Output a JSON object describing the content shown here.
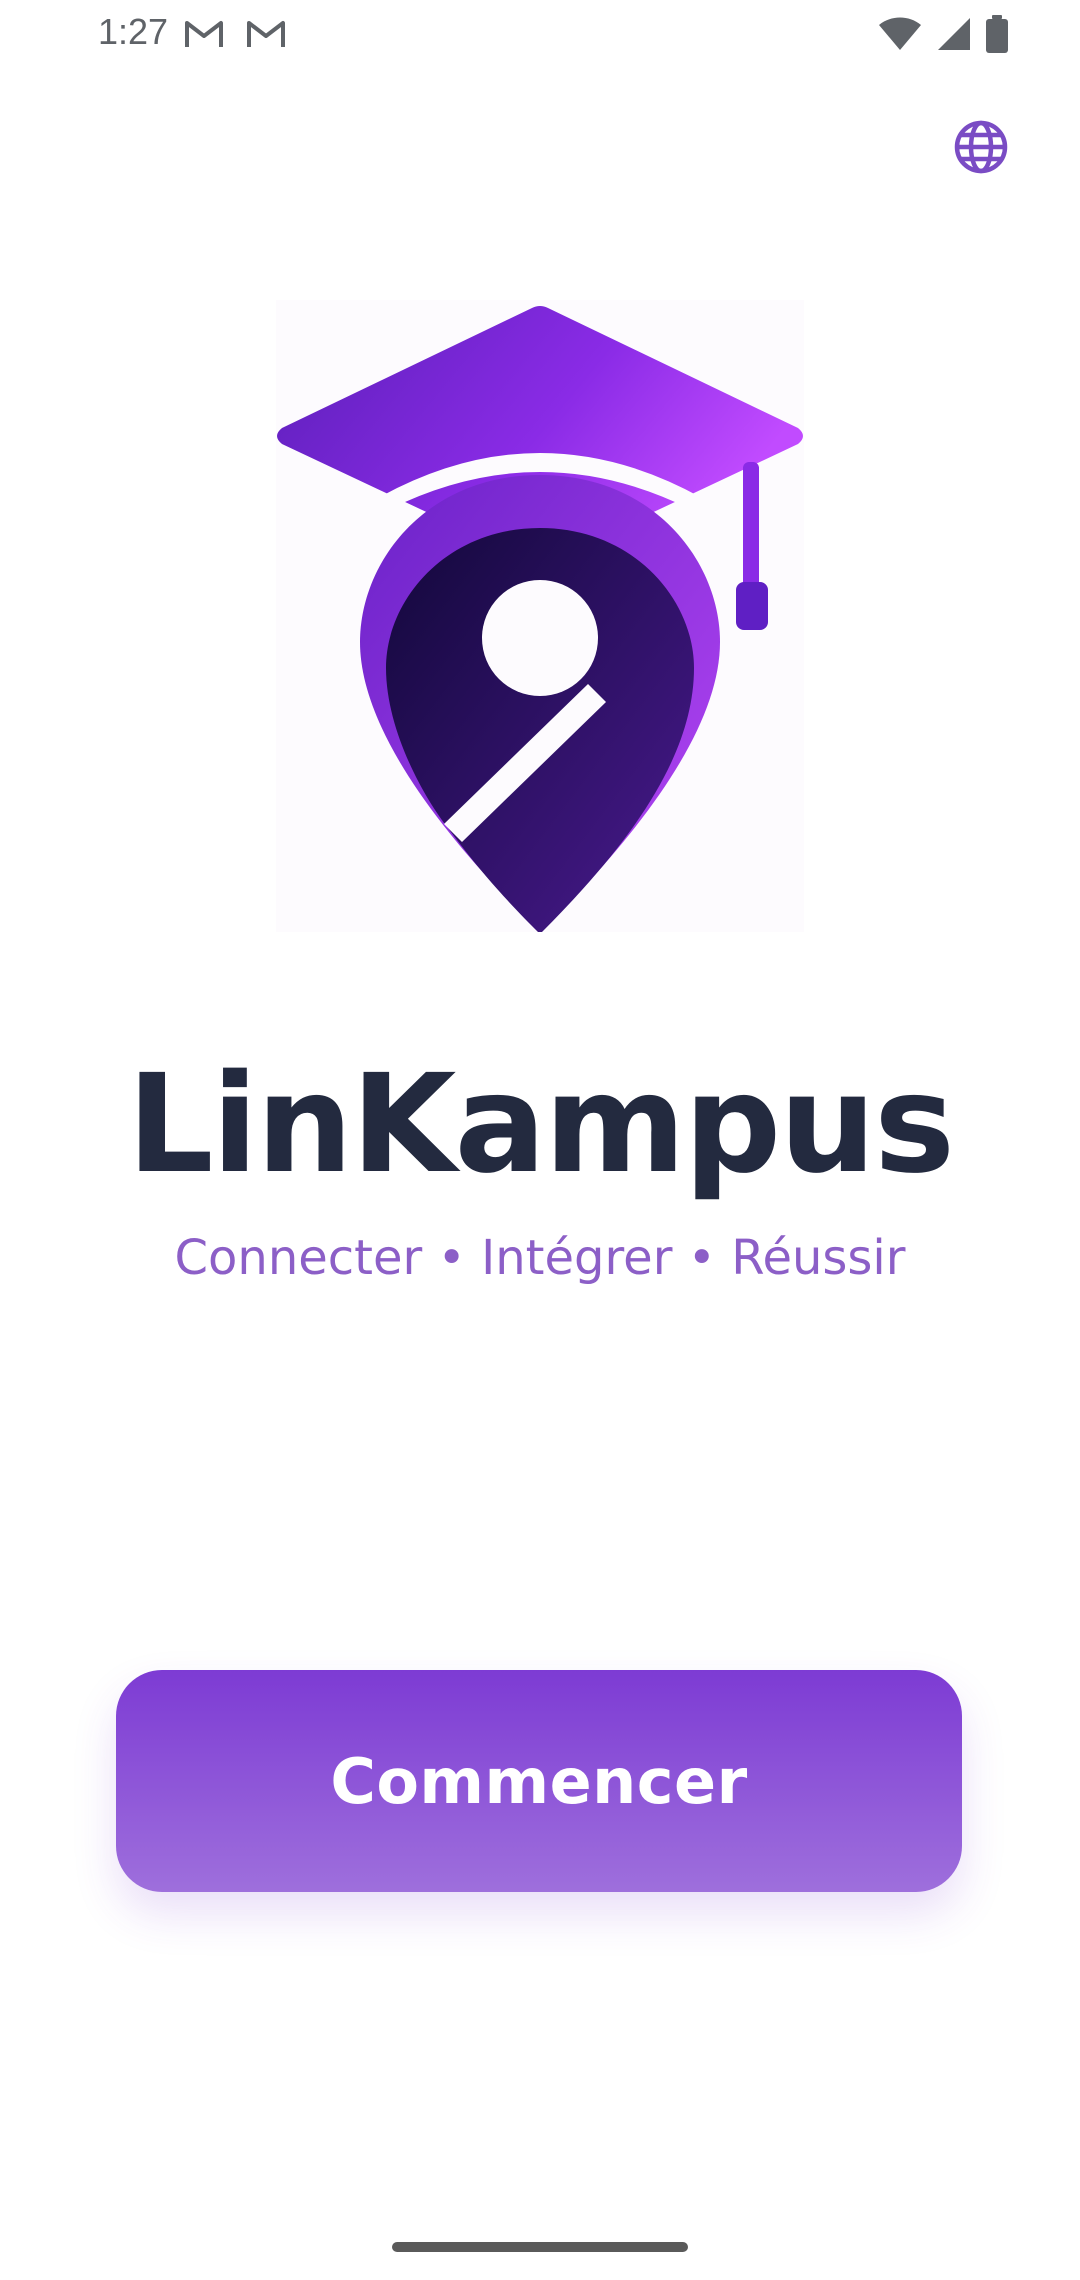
{
  "status_bar": {
    "time": "1:27",
    "icons": [
      "gmail-icon",
      "gmail-icon",
      "wifi-icon",
      "signal-icon",
      "battery-icon"
    ]
  },
  "header": {
    "language_icon": "globe-icon"
  },
  "brand": {
    "name": "LinKampus",
    "tagline": "Connecter • Intégrer • Réussir",
    "logo_icon": "graduation-cap-location-pin-logo"
  },
  "actions": {
    "start_label": "Commencer"
  },
  "colors": {
    "accent": "#7d3bd4",
    "accent_light": "#9e6fdc",
    "title": "#232a3f",
    "tagline": "#8c5fc7",
    "icon_globe": "#7a4cc4"
  }
}
